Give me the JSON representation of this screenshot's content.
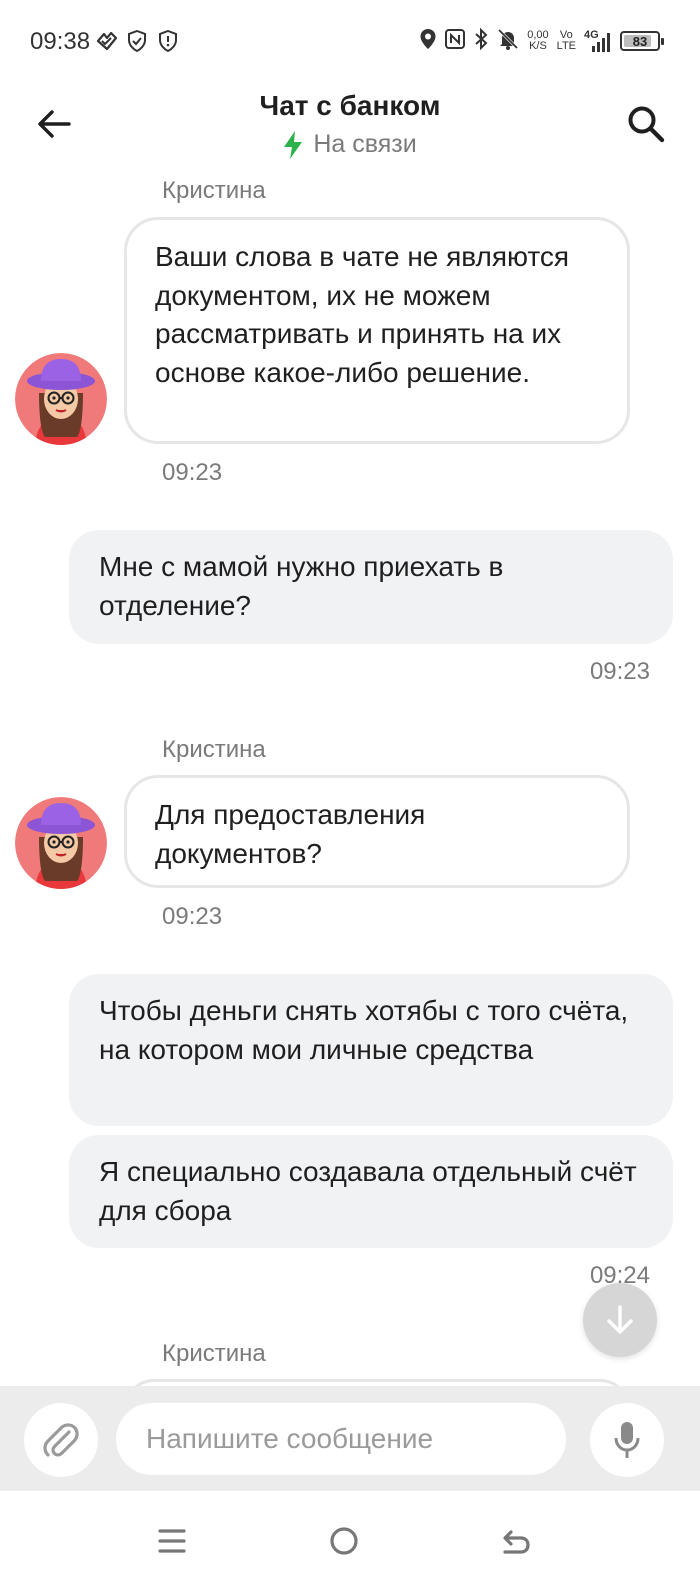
{
  "status_bar": {
    "time": "09:38",
    "net_speed_value": "0,00",
    "net_speed_unit": "K/S",
    "volte_top": "Vo",
    "volte_bottom": "LTE",
    "network": "4G",
    "battery": "83",
    "battery_level": 0.83
  },
  "header": {
    "title": "Чат с банком",
    "status": "На связи"
  },
  "messages": [
    {
      "direction": "incoming",
      "sender": "Кристина",
      "text": "Ваши слова в чате не являются документом, их не можем рассматривать и принять на их основе какое-либо решение.",
      "time": "09:23"
    },
    {
      "direction": "outgoing",
      "text": "Мне с мамой нужно приехать в отделение?",
      "time": "09:23"
    },
    {
      "direction": "incoming",
      "sender": "Кристина",
      "text": "Для предоставления документов?",
      "time": "09:23"
    },
    {
      "direction": "outgoing",
      "text": "Чтобы деньги снять хотябы с того счёта, на котором мои личные средства",
      "time": ""
    },
    {
      "direction": "outgoing",
      "text": "Я специально создавала отдельный счёт для сбора",
      "time": "09:24"
    },
    {
      "direction": "incoming",
      "sender": "Кристина",
      "text": "",
      "time": ""
    }
  ],
  "composer": {
    "placeholder": "Напишите сообщение"
  },
  "colors": {
    "accent_online": "#2bb24c",
    "bubble_out_bg": "#f1f2f4",
    "bubble_in_border": "#e6e6e6"
  }
}
